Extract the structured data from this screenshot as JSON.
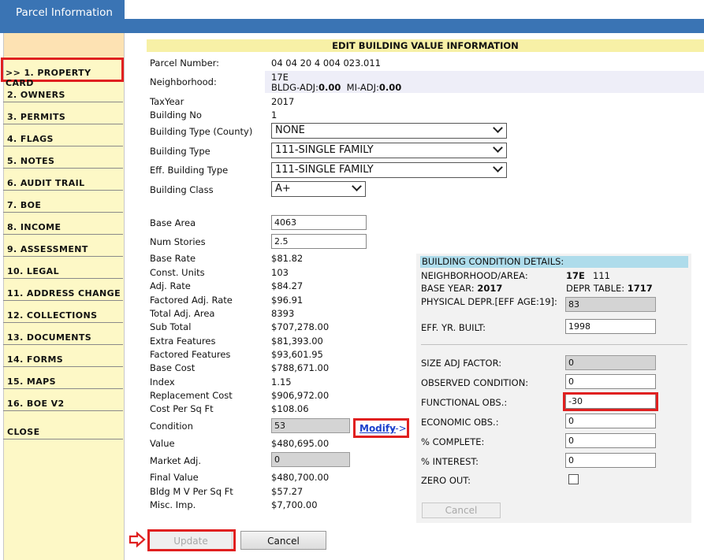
{
  "tab": {
    "label": "Parcel Information"
  },
  "sidebar": {
    "items": [
      {
        "label": ">> 1. PROPERTY CARD"
      },
      {
        "label": "2. OWNERS"
      },
      {
        "label": "3. PERMITS"
      },
      {
        "label": "4. FLAGS"
      },
      {
        "label": "5. NOTES"
      },
      {
        "label": "6. AUDIT TRAIL"
      },
      {
        "label": "7. BOE"
      },
      {
        "label": "8. INCOME"
      },
      {
        "label": "9. ASSESSMENT"
      },
      {
        "label": "10. LEGAL"
      },
      {
        "label": "11. ADDRESS CHANGE"
      },
      {
        "label": "12. COLLECTIONS"
      },
      {
        "label": "13. DOCUMENTS"
      },
      {
        "label": "14. FORMS"
      },
      {
        "label": "15. MAPS"
      },
      {
        "label": "16. BOE V2"
      },
      {
        "label": "CLOSE"
      }
    ]
  },
  "form": {
    "header": "EDIT BUILDING VALUE INFORMATION",
    "parcel_number": {
      "label": "Parcel Number:",
      "value": "04 04 20 4 004 023.011"
    },
    "neighborhood": {
      "label": "Neighborhood:",
      "value": "17E",
      "bldg_adj_label": "BLDG-ADJ:",
      "bldg_adj_value": "0.00",
      "mi_adj_label": "MI-ADJ:",
      "mi_adj_value": "0.00"
    },
    "tax_year": {
      "label": "TaxYear",
      "value": "2017"
    },
    "building_no": {
      "label": "Building No",
      "value": "1"
    },
    "building_type_county": {
      "label": "Building Type (County)",
      "value": "NONE"
    },
    "building_type": {
      "label": "Building Type",
      "value": "111-SINGLE FAMILY"
    },
    "eff_building_type": {
      "label": "Eff. Building Type",
      "value": "111-SINGLE FAMILY"
    },
    "building_class": {
      "label": "Building Class",
      "value": "A+"
    },
    "base_area": {
      "label": "Base Area",
      "value": "4063"
    },
    "num_stories": {
      "label": "Num Stories",
      "value": "2.5"
    },
    "base_rate": {
      "label": "Base Rate",
      "value": "$81.82"
    },
    "const_units": {
      "label": "Const. Units",
      "value": "103"
    },
    "adj_rate": {
      "label": "Adj. Rate",
      "value": "$84.27"
    },
    "factored_adj_rate": {
      "label": "Factored Adj. Rate",
      "value": "$96.91"
    },
    "total_adj_area": {
      "label": "Total Adj. Area",
      "value": "8393"
    },
    "sub_total": {
      "label": "Sub Total",
      "value": "$707,278.00"
    },
    "extra_features": {
      "label": "Extra Features",
      "value": "$81,393.00"
    },
    "factored_features": {
      "label": "Factored Features",
      "value": "$93,601.95"
    },
    "base_cost": {
      "label": "Base Cost",
      "value": "$788,671.00"
    },
    "index": {
      "label": "Index",
      "value": "1.15"
    },
    "replacement_cost": {
      "label": "Replacement Cost",
      "value": "$906,972.00"
    },
    "cost_per_sq_ft": {
      "label": "Cost Per Sq Ft",
      "value": "$108.06"
    },
    "condition": {
      "label": "Condition",
      "value": "53"
    },
    "modify": {
      "label": "Modify",
      "arrow": "-->"
    },
    "value": {
      "label": "Value",
      "value": "$480,695.00"
    },
    "market_adj": {
      "label": "Market Adj.",
      "value": "0"
    },
    "final_value": {
      "label": "Final Value",
      "value": "$480,700.00"
    },
    "bldg_mv_per_sq_ft": {
      "label": "Bldg M V Per Sq Ft",
      "value": "$57.27"
    },
    "misc_imp": {
      "label": "Misc. Imp.",
      "value": "$7,700.00"
    },
    "update_label": "Update",
    "cancel_label": "Cancel"
  },
  "condition_panel": {
    "header": "BUILDING CONDITION DETAILS:",
    "neighborhood_area": {
      "label": "NEIGHBORHOOD/AREA:",
      "value1": "17E",
      "value2": "111"
    },
    "base_year": {
      "label": "BASE YEAR:",
      "value": "2017"
    },
    "depr_table": {
      "label": "DEPR TABLE:",
      "value": "1717"
    },
    "physical_depr": {
      "label": "PHYSICAL DEPR.[EFF AGE:19]:",
      "value": "83"
    },
    "eff_yr_built": {
      "label": "EFF. YR. BUILT:",
      "value": "1998"
    },
    "size_adj_factor": {
      "label": "SIZE ADJ FACTOR:",
      "value": "0"
    },
    "observed_condition": {
      "label": "OBSERVED CONDITION:",
      "value": "0"
    },
    "functional_obs": {
      "label": "FUNCTIONAL OBS.:",
      "value": "-30"
    },
    "economic_obs": {
      "label": "ECONOMIC OBS.:",
      "value": "0"
    },
    "pct_complete": {
      "label": "% COMPLETE:",
      "value": "0"
    },
    "pct_interest": {
      "label": "% INTEREST:",
      "value": "0"
    },
    "zero_out": {
      "label": "ZERO OUT:"
    },
    "cancel_label": "Cancel"
  },
  "colors": {
    "highlight": "#e02020",
    "tab": "#3a74b4",
    "sidebar": "#fdf8c6",
    "header": "#f7f0a6",
    "panel_header": "#aedceb"
  }
}
